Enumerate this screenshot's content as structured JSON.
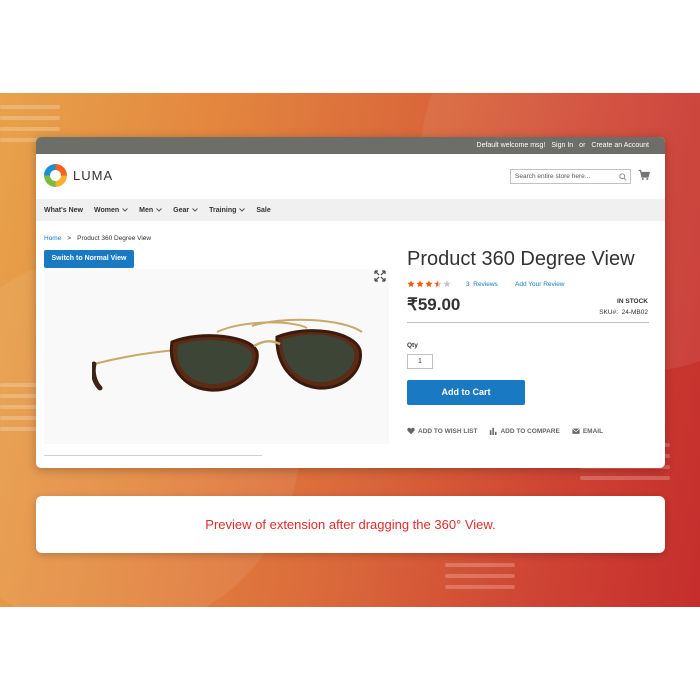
{
  "top_bar": {
    "welcome": "Default welcome msg!",
    "sign_in": "Sign In",
    "or": "or",
    "create_account": "Create an Account"
  },
  "header": {
    "logo_text": "LUMA",
    "search_placeholder": "Search entire store here..."
  },
  "nav": {
    "items": [
      {
        "label": "What's New",
        "has_dropdown": false
      },
      {
        "label": "Women",
        "has_dropdown": true
      },
      {
        "label": "Men",
        "has_dropdown": true
      },
      {
        "label": "Gear",
        "has_dropdown": true
      },
      {
        "label": "Training",
        "has_dropdown": true
      },
      {
        "label": "Sale",
        "has_dropdown": false
      }
    ]
  },
  "breadcrumb": {
    "home": "Home",
    "separator": ">",
    "current": "Product 360 Degree View"
  },
  "gallery": {
    "switch_button": "Switch to Normal View"
  },
  "product": {
    "title": "Product 360 Degree View",
    "rating_stars": 3.5,
    "review_count": "3",
    "reviews_label": "Reviews",
    "add_review": "Add Your Review",
    "price": "₹59.00",
    "stock": "IN STOCK",
    "sku_label": "SKU#:",
    "sku": "24-MB02",
    "qty_label": "Qty",
    "qty_value": "1",
    "add_to_cart": "Add to Cart",
    "wishlist": "ADD TO WISH LIST",
    "compare": "ADD TO COMPARE",
    "email": "EMAIL"
  },
  "caption": "Preview of extension after dragging the 360° View.",
  "colors": {
    "accent": "#1979c3",
    "star": "#ff5501",
    "caption_text": "#e22a2a",
    "top_bar": "#6d6e6a"
  }
}
